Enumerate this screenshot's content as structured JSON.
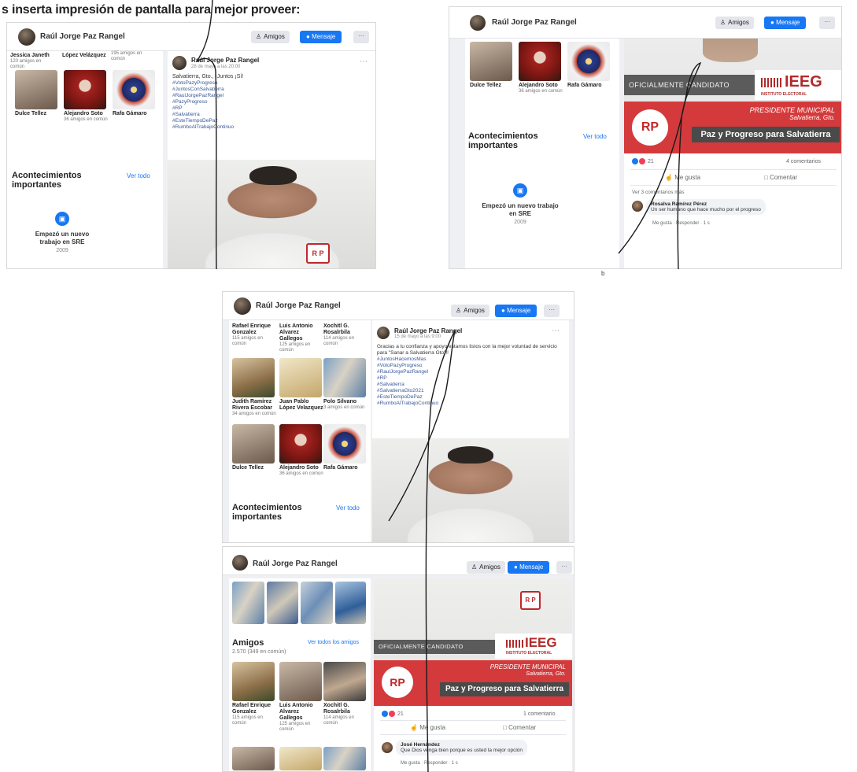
{
  "caption": "s inserta impresión de pantalla para mejor proveer:",
  "corner_mark": "b",
  "profile": {
    "name": "Raúl Jorge Paz Rangel",
    "btn_friends": "Amigos",
    "btn_message": "Mensaje",
    "btn_more": "···"
  },
  "shot1": {
    "top_friends": [
      {
        "name": "Jessica Janeth",
        "sub": "120 amigos en común"
      },
      {
        "name": "López Velázquez",
        "sub": ""
      },
      {
        "name": "",
        "sub": "195 amigos en común"
      }
    ],
    "friends": [
      {
        "name": "Dulce Tellez",
        "sub": ""
      },
      {
        "name": "Alejandro Soto",
        "sub": "36 amigos en común"
      },
      {
        "name": "Rafa Gámaro",
        "sub": ""
      }
    ],
    "events_title": "Acontecimientos importantes",
    "see_all": "Ver todo",
    "work": {
      "text": "Empezó un nuevo trabajo en SRE",
      "year": "2009"
    },
    "post": {
      "author": "Raúl Jorge Paz Rangel",
      "meta": "28 de mayo a las 20:00",
      "text": "Salvatierra, Gto., ¡Juntos ¡Sí!",
      "hashtags": [
        "#VotoPazyProgreso",
        "#JuntosConSalvatierra",
        "#RaulJorgePazRangel",
        "#PazyProgreso",
        "#RP",
        "#Salvatierra",
        "#EsteTiempoDePaz",
        "#RumboAlTrabajoContinuo"
      ]
    }
  },
  "shot2": {
    "friends": [
      {
        "name": "Dulce Tellez",
        "sub": ""
      },
      {
        "name": "Alejandro Soto",
        "sub": "36 amigos en común"
      },
      {
        "name": "Rafa Gámaro",
        "sub": ""
      }
    ],
    "events_title": "Acontecimientos importantes",
    "see_all": "Ver todo",
    "work": {
      "text": "Empezó un nuevo trabajo en SRE",
      "year": "2009"
    },
    "banner": {
      "oficial": "OFICIALMENTE CANDIDATO",
      "ieeg": "IEEG",
      "ieeg_sub": "INSTITUTO ELECTORAL",
      "rp": "RP",
      "pm_line1": "PRESIDENTE MUNICIPAL",
      "pm_line2": "Salvatierra, Gto.",
      "slogan": "Paz y Progreso para Salvatierra"
    },
    "reactions_count": "21",
    "comments_count": "4 comentarios",
    "like": "Me gusta",
    "comment": "Comentar",
    "see_more_comments": "Ver 3 comentarios más",
    "comment1": {
      "author": "Rosalva Ramírez Pérez",
      "text": "Un ser humano que hace mucho por el progreso",
      "links": "Me gusta · Responder · 1 s"
    }
  },
  "shot3": {
    "top_friends": [
      {
        "name": "Rafael Enrique Gonzalez",
        "sub": "115 amigos en común"
      },
      {
        "name": "Luis Antonio Alvarez Gallegos",
        "sub": "125 amigos en común"
      },
      {
        "name": "Xochitl G. Rosalrbila",
        "sub": "114 amigos en común"
      }
    ],
    "friends_row2": [
      {
        "name": "Judith Ramírez Rivera Escobar",
        "sub": "34 amigos en común"
      },
      {
        "name": "Juan Pablo López Velazquez",
        "sub": ""
      },
      {
        "name": "Polo Silvano",
        "sub": "3 amigos en común"
      }
    ],
    "friends_row3": [
      {
        "name": "Dulce Tellez",
        "sub": ""
      },
      {
        "name": "Alejandro Soto",
        "sub": "36 amigos en común"
      },
      {
        "name": "Rafa Gámaro",
        "sub": ""
      }
    ],
    "events_title": "Acontecimientos importantes",
    "see_all": "Ver todo",
    "post": {
      "author": "Raúl Jorge Paz Rangel",
      "meta": "15 de mayo a las 9:00",
      "text": "Gracias a tu confianza y apoyo estamos listos con la mejor voluntad de servicio para \"Sanar a Salvatierra Gto\"!!",
      "hashtags": [
        "#JuntosHacemosMas",
        "#VotoPazyProgreso",
        "#RaulJorgePazRangel",
        "#RP",
        "#Salvatierra",
        "#SalvatierraGto2021",
        "#EsteTiempoDePaz",
        "#RumboAlTrabajoContinuo"
      ]
    }
  },
  "shot4": {
    "friends_title": "Amigos",
    "friends_count": "2.570 (349 en común)",
    "see_all_friends": "Ver todos los amigos",
    "friends": [
      {
        "name": "Rafael Enrique Gonzalez",
        "sub": "115 amigos en común"
      },
      {
        "name": "Luis Antonio Alvarez Gallegos",
        "sub": "125 amigos en común"
      },
      {
        "name": "Xochitl G. Rosalrbila",
        "sub": "114 amigos en común"
      }
    ],
    "banner": {
      "oficial": "OFICIALMENTE CANDIDATO",
      "ieeg": "IEEG",
      "ieeg_sub": "INSTITUTO ELECTORAL",
      "rp": "RP",
      "pm_line1": "PRESIDENTE MUNICIPAL",
      "pm_line2": "Salvatierra, Gto.",
      "slogan": "Paz y Progreso para Salvatierra"
    },
    "reactions_count": "21",
    "comments_count": "1 comentario",
    "like": "Me gusta",
    "comment": "Comentar",
    "comment1": {
      "author": "José Hernández",
      "text": "Que Dios venga bien porque es usted la mejor opción",
      "links": "Me gusta · Responder · 1 s"
    }
  },
  "colors": {
    "accent": "#1877f2",
    "brand_red": "#d43a3c",
    "banner_gray": "#5b5b5b"
  }
}
